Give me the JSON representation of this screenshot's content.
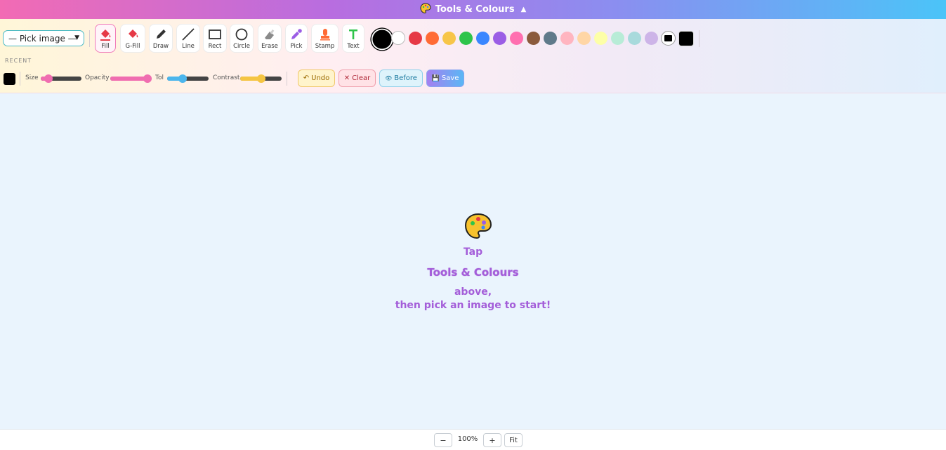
{
  "header": {
    "title": "Tools & Colours",
    "icon": "palette-icon",
    "toggle_glyph": "▲"
  },
  "image_select": {
    "value": "— Pick image —"
  },
  "tools": [
    {
      "id": "fill",
      "label": "Fill",
      "icon": "paint-bucket-icon",
      "active": true
    },
    {
      "id": "gfill",
      "label": "G-Fill",
      "icon": "gradient-fill-icon",
      "active": false
    },
    {
      "id": "draw",
      "label": "Draw",
      "icon": "pencil-icon",
      "active": false
    },
    {
      "id": "line",
      "label": "Line",
      "icon": "line-icon",
      "active": false
    },
    {
      "id": "rect",
      "label": "Rect",
      "icon": "rectangle-icon",
      "active": false
    },
    {
      "id": "circle",
      "label": "Circle",
      "icon": "circle-icon",
      "active": false
    },
    {
      "id": "erase",
      "label": "Erase",
      "icon": "eraser-icon",
      "active": false
    },
    {
      "id": "pick",
      "label": "Pick",
      "icon": "eyedropper-icon",
      "active": false
    },
    {
      "id": "stamp",
      "label": "Stamp",
      "icon": "stamp-icon",
      "active": false
    },
    {
      "id": "text",
      "label": "Text",
      "icon": "text-icon",
      "active": false
    }
  ],
  "palette": {
    "selected": "#000000",
    "colors": [
      "#000000",
      "#ffffff",
      "#e63946",
      "#ff6b35",
      "#f7c548",
      "#2ec44a",
      "#3a86ff",
      "#9b5de5",
      "#ff6fb0",
      "#8b5a3c",
      "#5f7a8a",
      "#ffb5c0",
      "#ffd6a5",
      "#fdffa8",
      "#b8ecd7",
      "#a8dadc",
      "#cdb4e8"
    ],
    "custom_picker": "#000000",
    "custom_swatch": "#000000"
  },
  "recent": {
    "label": "RECENT",
    "colors": [
      "#000000"
    ]
  },
  "sliders": {
    "size": {
      "label": "Size",
      "value": 0.1
    },
    "opacity": {
      "label": "Opacity",
      "value": 1.0
    },
    "tol": {
      "label": "Tol",
      "value": 0.35
    },
    "contrast": {
      "label": "Contrast",
      "value": 0.5
    }
  },
  "actions": {
    "undo": {
      "glyph": "↶",
      "label": "Undo"
    },
    "clear": {
      "glyph": "✕",
      "label": "Clear"
    },
    "before": {
      "glyph": "👁",
      "label": "Before"
    },
    "save": {
      "glyph": "💾",
      "label": "Save"
    }
  },
  "canvas_message": {
    "line1": "Tap",
    "line2": "Tools & Colours",
    "line3": "above,",
    "line4": "then pick an image to start!"
  },
  "zoom": {
    "minus": "−",
    "value": "100%",
    "plus": "+",
    "fit": "Fit"
  }
}
